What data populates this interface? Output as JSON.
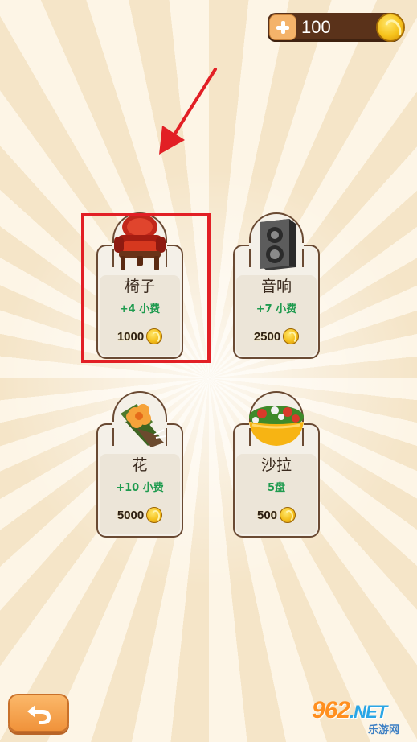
{
  "header": {
    "coins": "100",
    "add_icon": "plus-icon",
    "coin_icon": "gold-coin-icon"
  },
  "annotation": {
    "arrow_color": "#e21f25",
    "highlighted_item": "椅子"
  },
  "shop": {
    "items": [
      {
        "name": "椅子",
        "effect": "+4 小费",
        "price": "1000",
        "icon": "armchair-icon"
      },
      {
        "name": "音响",
        "effect": "+7 小费",
        "price": "2500",
        "icon": "speaker-icon"
      },
      {
        "name": "花",
        "effect": "+10 小费",
        "price": "5000",
        "icon": "flower-bouquet-icon"
      },
      {
        "name": "沙拉",
        "effect": "5盘",
        "price": "500",
        "icon": "salad-bowl-icon"
      }
    ]
  },
  "footer": {
    "back_icon": "back-arrow-icon",
    "watermark_main": "962",
    "watermark_net": ".NET",
    "watermark_sub": "乐游网"
  },
  "colors": {
    "effect_green": "#1f9b4f",
    "coin_bar": "#5a321a",
    "back_button": "#f0923a"
  }
}
